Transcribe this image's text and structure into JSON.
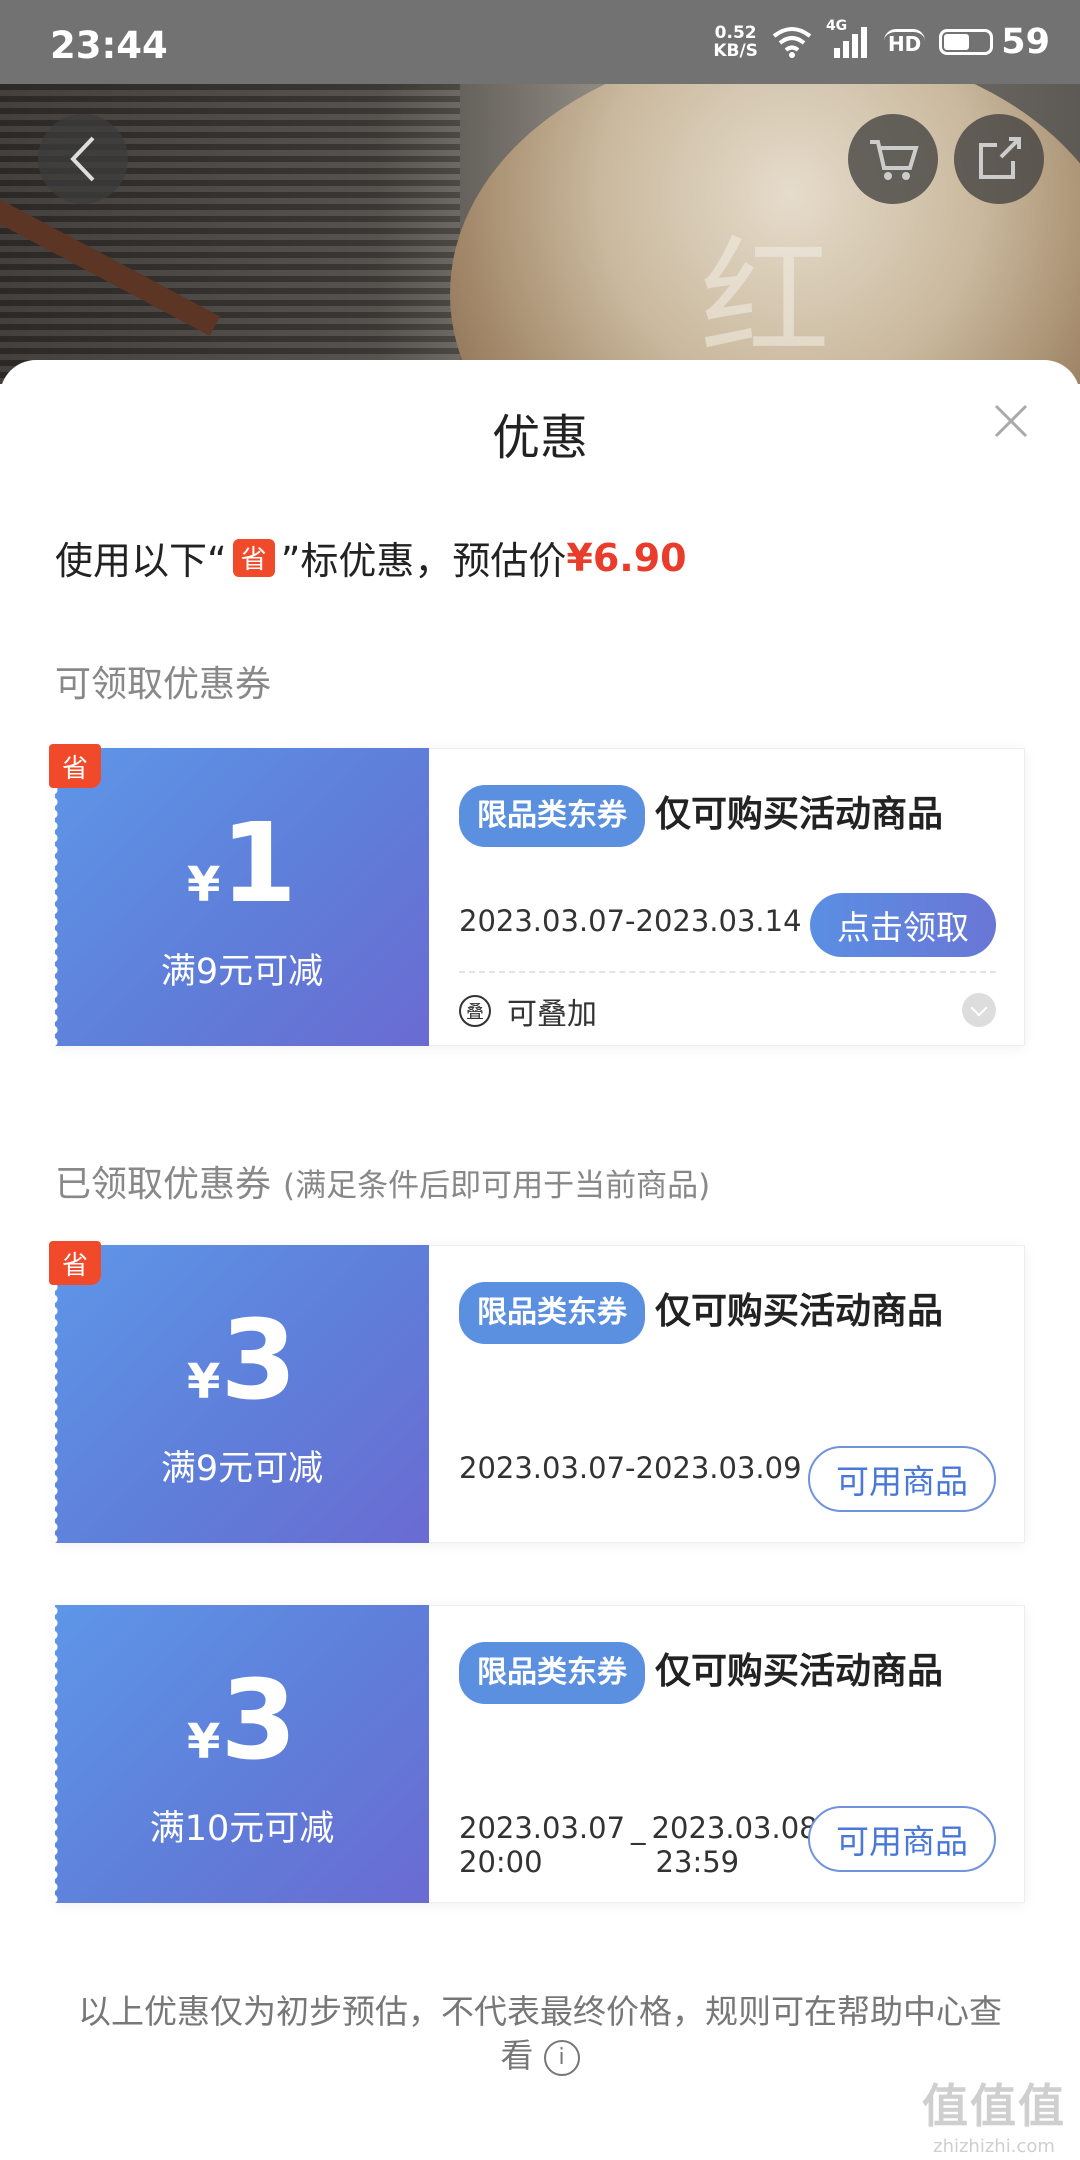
{
  "status_bar": {
    "time": "23:44",
    "net_speed_value": "0.52",
    "net_speed_unit": "KB/S",
    "signal_label": "4G",
    "hd_label": "HD",
    "battery": "59",
    "battery_fraction": 0.59
  },
  "hero": {
    "overlay_char": "红"
  },
  "sheet": {
    "title": "优惠",
    "summary_prefix": "使用以下“",
    "save_badge": "省",
    "summary_middle": "”标优惠，预估价",
    "estimated_price": "¥6.90"
  },
  "sections": {
    "claimable_title": "可领取优惠券",
    "claimed_title": "已领取优惠券",
    "claimed_note": "(满足条件后即可用于当前商品)"
  },
  "coupons": [
    {
      "yen": "¥",
      "amount": "1",
      "condition": "满9元可减",
      "tag": "限品类东券",
      "title": "仅可购买活动商品",
      "date": "2023.03.07-2023.03.14",
      "button": "点击领取",
      "stack_icon": "叠",
      "stack_label": "可叠加",
      "badge": "省"
    },
    {
      "yen": "¥",
      "amount": "3",
      "condition": "满9元可减",
      "tag": "限品类东券",
      "title": "仅可购买活动商品",
      "date": "2023.03.07-2023.03.09",
      "button": "可用商品",
      "badge": "省"
    },
    {
      "yen": "¥",
      "amount": "3",
      "condition": "满10元可减",
      "tag": "限品类东券",
      "title": "仅可购买活动商品",
      "date_start": "2023.03.07",
      "time_start": "20:00",
      "date_sep": "_",
      "date_end": "2023.03.08",
      "time_end": "23:59",
      "button": "可用商品"
    }
  ],
  "footer": {
    "text": "以上优惠仅为初步预估，不代表最终价格，规则可在帮助中心查看",
    "info_icon": "i"
  },
  "watermark": {
    "logo": "值值值",
    "url": "zhizhizhi.com"
  }
}
